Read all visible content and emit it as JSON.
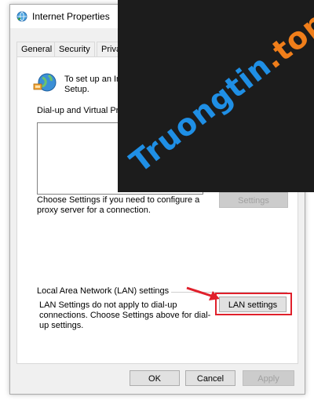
{
  "window": {
    "title": "Internet Properties",
    "tabs": [
      {
        "label": "General"
      },
      {
        "label": "Security"
      },
      {
        "label": "Privacy"
      }
    ]
  },
  "panel": {
    "setup_text": "To set up an Inte\nSetup.",
    "dialup_label": "Dial-up and Virtual Private",
    "choose_settings_text": "Choose Settings if you need to configure a proxy server for a connection.",
    "settings_button": "Settings",
    "lan_section_label": "Local Area Network (LAN) settings",
    "lan_text": "LAN Settings do not apply to dial-up connections. Choose Settings above for dial-up settings.",
    "lan_button": "LAN settings"
  },
  "footer": {
    "ok": "OK",
    "cancel": "Cancel",
    "apply": "Apply"
  },
  "watermark": {
    "name": "Truongtin",
    "tld": ".top"
  },
  "colors": {
    "highlight": "#e0202b",
    "watermark_blue": "#1f8fe5",
    "watermark_orange": "#f07e1a",
    "overlay_dark": "#1c1c1c"
  },
  "icons": {
    "title_icon": "internet-options-globe-icon",
    "panel_icon": "network-globe-icon",
    "annotation": "red-arrow-icon"
  }
}
